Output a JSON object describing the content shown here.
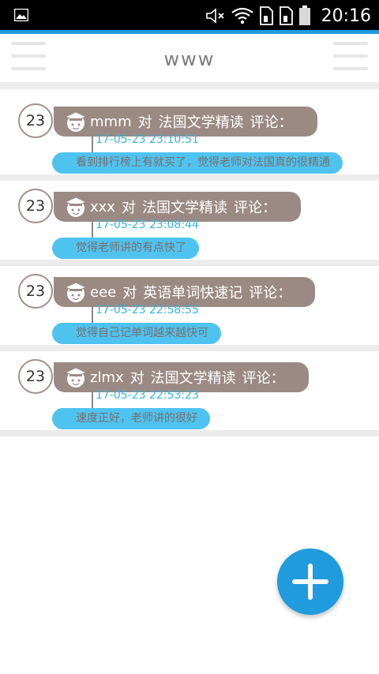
{
  "status_bar": {
    "time": "20:16",
    "icons": [
      "image-icon",
      "mute-icon",
      "wifi-icon",
      "sim1-icon",
      "sim2-icon",
      "battery-icon"
    ]
  },
  "app_bar": {
    "title": "www"
  },
  "comments": [
    {
      "count": "23",
      "user": "mmm",
      "verb": "对",
      "course": "法国文学精读",
      "action": "评论：",
      "time": "17-05-23 23:10:51",
      "text": "看到排行榜上有就买了，觉得老师对法国真的很精通"
    },
    {
      "count": "23",
      "user": "xxx",
      "verb": "对",
      "course": "法国文学精读",
      "action": "评论：",
      "time": "17-05-23 23:08:44",
      "text": "觉得老师讲的有点快了"
    },
    {
      "count": "23",
      "user": "eee",
      "verb": "对",
      "course": "英语单词快速记",
      "action": "评论：",
      "time": "17-05-23 22:58:55",
      "text": "觉得自己记单词越来越快可"
    },
    {
      "count": "23",
      "user": "zlmx",
      "verb": "对",
      "course": "法国文学精读",
      "action": "评论：",
      "time": "17-05-23 22:53:23",
      "text": "速度正好，老师讲的很好"
    }
  ],
  "fab": {
    "icon": "plus-icon"
  },
  "colors": {
    "accent": "#1f9bde",
    "pill": "#9b8a84",
    "comment": "#4fc3f0",
    "time": "#33b5e5"
  }
}
